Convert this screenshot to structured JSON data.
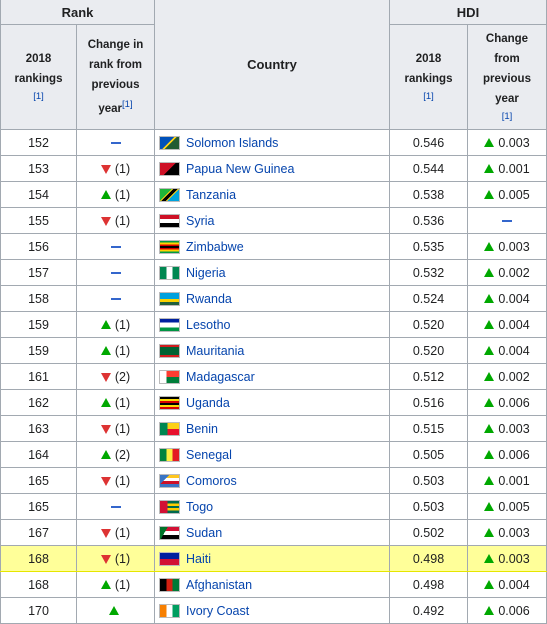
{
  "header": {
    "rank_group": "Rank",
    "hdi_group": "HDI",
    "rank_2018_lines": [
      "2018",
      "rankings"
    ],
    "rank_change_lines": [
      "Change in",
      "rank from",
      "previous",
      "year"
    ],
    "country": "Country",
    "hdi_2018_lines": [
      "2018",
      "rankings"
    ],
    "hdi_change_lines": [
      "Change",
      "from",
      "previous",
      "year"
    ],
    "ref": "[1]"
  },
  "colors": {
    "up": "#00a800",
    "down": "#dd3333",
    "same": "#3366cc",
    "link": "#0645ad",
    "highlight": "#ffff99"
  },
  "rows": [
    {
      "rank": "152",
      "dir": "same",
      "change": "",
      "country": "Solomon Islands",
      "flag": "solomon-islands-flag",
      "hdi": "0.546",
      "hdir": "up",
      "hchange": "0.003"
    },
    {
      "rank": "153",
      "dir": "down",
      "change": "(1)",
      "country": "Papua New Guinea",
      "flag": "papua-new-guinea-flag",
      "hdi": "0.544",
      "hdir": "up",
      "hchange": "0.001"
    },
    {
      "rank": "154",
      "dir": "up",
      "change": "(1)",
      "country": "Tanzania",
      "flag": "tanzania-flag",
      "hdi": "0.538",
      "hdir": "up",
      "hchange": "0.005"
    },
    {
      "rank": "155",
      "dir": "down",
      "change": "(1)",
      "country": "Syria",
      "flag": "syria-flag",
      "hdi": "0.536",
      "hdir": "same",
      "hchange": ""
    },
    {
      "rank": "156",
      "dir": "same",
      "change": "",
      "country": "Zimbabwe",
      "flag": "zimbabwe-flag",
      "hdi": "0.535",
      "hdir": "up",
      "hchange": "0.003"
    },
    {
      "rank": "157",
      "dir": "same",
      "change": "",
      "country": "Nigeria",
      "flag": "nigeria-flag",
      "hdi": "0.532",
      "hdir": "up",
      "hchange": "0.002"
    },
    {
      "rank": "158",
      "dir": "same",
      "change": "",
      "country": "Rwanda",
      "flag": "rwanda-flag",
      "hdi": "0.524",
      "hdir": "up",
      "hchange": "0.004"
    },
    {
      "rank": "159",
      "dir": "up",
      "change": "(1)",
      "country": "Lesotho",
      "flag": "lesotho-flag",
      "hdi": "0.520",
      "hdir": "up",
      "hchange": "0.004"
    },
    {
      "rank": "159",
      "dir": "up",
      "change": "(1)",
      "country": "Mauritania",
      "flag": "mauritania-flag",
      "hdi": "0.520",
      "hdir": "up",
      "hchange": "0.004"
    },
    {
      "rank": "161",
      "dir": "down",
      "change": "(2)",
      "country": "Madagascar",
      "flag": "madagascar-flag",
      "hdi": "0.512",
      "hdir": "up",
      "hchange": "0.002"
    },
    {
      "rank": "162",
      "dir": "up",
      "change": "(1)",
      "country": "Uganda",
      "flag": "uganda-flag",
      "hdi": "0.516",
      "hdir": "up",
      "hchange": "0.006"
    },
    {
      "rank": "163",
      "dir": "down",
      "change": "(1)",
      "country": "Benin",
      "flag": "benin-flag",
      "hdi": "0.515",
      "hdir": "up",
      "hchange": "0.003"
    },
    {
      "rank": "164",
      "dir": "up",
      "change": "(2)",
      "country": "Senegal",
      "flag": "senegal-flag",
      "hdi": "0.505",
      "hdir": "up",
      "hchange": "0.006"
    },
    {
      "rank": "165",
      "dir": "down",
      "change": "(1)",
      "country": "Comoros",
      "flag": "comoros-flag",
      "hdi": "0.503",
      "hdir": "up",
      "hchange": "0.001"
    },
    {
      "rank": "165",
      "dir": "same",
      "change": "",
      "country": "Togo",
      "flag": "togo-flag",
      "hdi": "0.503",
      "hdir": "up",
      "hchange": "0.005"
    },
    {
      "rank": "167",
      "dir": "down",
      "change": "(1)",
      "country": "Sudan",
      "flag": "sudan-flag",
      "hdi": "0.502",
      "hdir": "up",
      "hchange": "0.003"
    },
    {
      "rank": "168",
      "dir": "down",
      "change": "(1)",
      "country": "Haiti",
      "flag": "haiti-flag",
      "hdi": "0.498",
      "hdir": "up",
      "hchange": "0.003",
      "highlight": true
    },
    {
      "rank": "168",
      "dir": "up",
      "change": "(1)",
      "country": "Afghanistan",
      "flag": "afghanistan-flag",
      "hdi": "0.498",
      "hdir": "up",
      "hchange": "0.004"
    },
    {
      "rank": "170",
      "dir": "up",
      "change": "",
      "country": "Ivory Coast",
      "flag": "ivory-coast-flag",
      "hdi": "0.492",
      "hdir": "up",
      "hchange": "0.006"
    }
  ]
}
